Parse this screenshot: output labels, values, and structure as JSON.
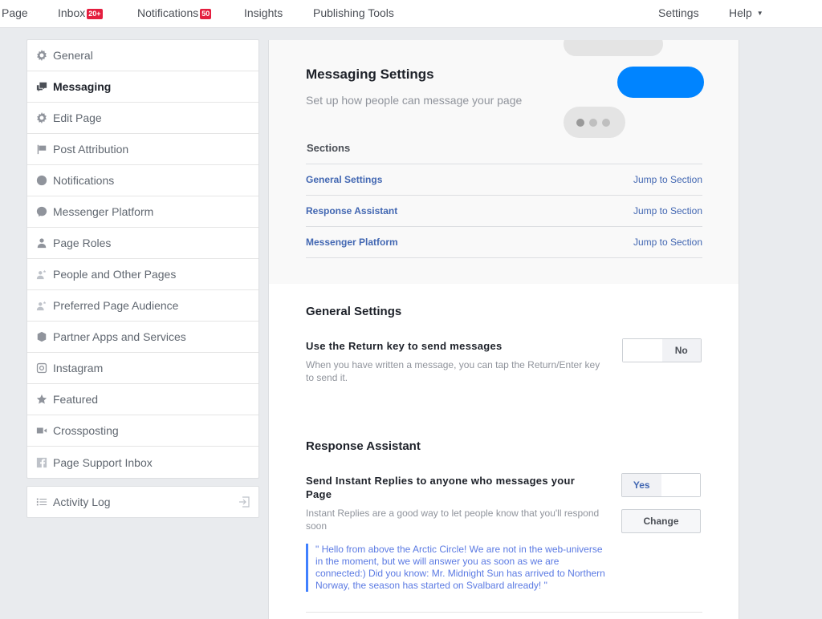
{
  "topnav": {
    "page": "Page",
    "inbox": "Inbox",
    "inbox_badge": "20+",
    "notifications": "Notifications",
    "notifications_badge": "50",
    "insights": "Insights",
    "publishing_tools": "Publishing Tools",
    "settings": "Settings",
    "help": "Help",
    "help_caret": "▼"
  },
  "sidebar": {
    "items": [
      {
        "label": "General",
        "icon": "gear-icon"
      },
      {
        "label": "Messaging",
        "icon": "messaging-icon",
        "active": true
      },
      {
        "label": "Edit Page",
        "icon": "gear-icon"
      },
      {
        "label": "Post Attribution",
        "icon": "flag-icon"
      },
      {
        "label": "Notifications",
        "icon": "globe-icon"
      },
      {
        "label": "Messenger Platform",
        "icon": "messenger-icon"
      },
      {
        "label": "Page Roles",
        "icon": "person-icon"
      },
      {
        "label": "People and Other Pages",
        "icon": "person-star-icon"
      },
      {
        "label": "Preferred Page Audience",
        "icon": "person-star-icon"
      },
      {
        "label": "Partner Apps and Services",
        "icon": "cube-icon"
      },
      {
        "label": "Instagram",
        "icon": "instagram-icon"
      },
      {
        "label": "Featured",
        "icon": "star-icon"
      },
      {
        "label": "Crossposting",
        "icon": "video-camera-icon"
      },
      {
        "label": "Page Support Inbox",
        "icon": "facebook-icon"
      }
    ],
    "activity_log": "Activity Log"
  },
  "hero": {
    "title": "Messaging Settings",
    "subtitle": "Set up how people can message your page",
    "accent_color": "#0084ff"
  },
  "sections": {
    "title": "Sections",
    "rows": [
      {
        "name": "General Settings",
        "jump": "Jump to Section"
      },
      {
        "name": "Response Assistant",
        "jump": "Jump to Section"
      },
      {
        "name": "Messenger Platform",
        "jump": "Jump to Section"
      }
    ]
  },
  "general_settings": {
    "title": "General Settings",
    "return_key": {
      "title": "Use the Return key to send messages",
      "description": "When you have written a message, you can tap the Return/Enter key to send it.",
      "toggle_value": "No"
    }
  },
  "response_assistant": {
    "title": "Response Assistant",
    "instant_replies": {
      "title": "Send Instant Replies to anyone who messages your Page",
      "description": "Instant Replies are a good way to let people know that you'll respond soon",
      "toggle_value": "Yes",
      "change_label": "Change",
      "message": "\" Hello from above the Arctic Circle! We are not in the web-universe in the moment, but we will answer you as soon as we are connected:) Did you know: Mr. Midnight Sun has arrived to Northern Norway, the season has started on Svalbard already! \""
    }
  }
}
